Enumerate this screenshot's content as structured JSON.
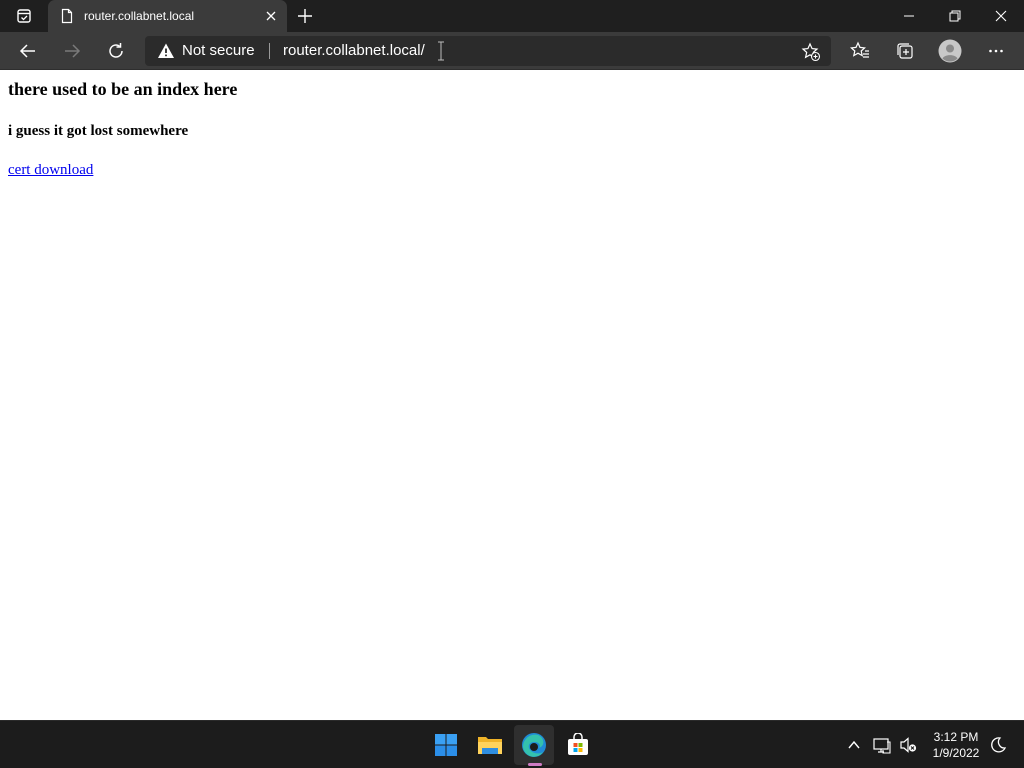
{
  "browser": {
    "tab": {
      "title": "router.collabnet.local"
    },
    "address_bar": {
      "security_label": "Not secure",
      "url": "router.collabnet.local/"
    }
  },
  "page": {
    "heading": "there used to be an index here",
    "subheading": "i guess it got lost somewhere",
    "link_text": "cert download"
  },
  "taskbar": {
    "time": "3:12 PM",
    "date": "1/9/2022"
  },
  "colors": {
    "titlebar": "#1f1f1f",
    "toolbar": "#3b3b3b",
    "link": "#0000ee",
    "taskbar": "#1c1c1c"
  },
  "icons": [
    "tab-actions-icon",
    "page-icon",
    "close-icon",
    "plus-icon",
    "minimize-icon",
    "restore-icon",
    "close-window-icon",
    "back-arrow-icon",
    "forward-arrow-icon",
    "refresh-icon",
    "warning-icon",
    "text-cursor-icon",
    "add-favorite-icon",
    "favorites-icon",
    "collections-icon",
    "profile-icon",
    "more-icon",
    "windows-start-icon",
    "file-explorer-icon",
    "edge-icon",
    "store-icon",
    "chevron-up-icon",
    "network-icon",
    "volume-muted-icon",
    "moon-icon"
  ]
}
